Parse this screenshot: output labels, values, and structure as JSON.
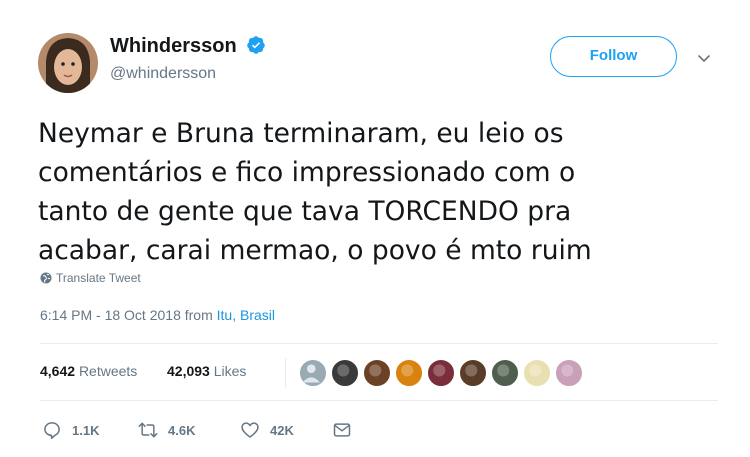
{
  "user": {
    "display_name": "Whindersson",
    "handle": "@whindersson",
    "verified": true
  },
  "follow_label": "Follow",
  "tweet": {
    "text_lines": [
      "Neymar e Bruna terminaram, eu leio os",
      "comentários e fico impressionado com o",
      "tanto de gente que tava TORCENDO pra",
      "acabar, carai mermao, o povo é mto ruim"
    ],
    "translate_label": "Translate Tweet",
    "time": "6:14 PM - 18 Oct 2018",
    "from_label": "from",
    "location": "Itu, Brasil"
  },
  "stats": {
    "retweets_count": "4,642",
    "retweets_label": "Retweets",
    "likes_count": "42,093",
    "likes_label": "Likes"
  },
  "liker_avatars": [
    {
      "icon": "default-avatar-icon",
      "color": "#99aab5"
    },
    {
      "icon": "avatar",
      "color": "#3a3a3a"
    },
    {
      "icon": "avatar",
      "color": "#6b4226"
    },
    {
      "icon": "avatar",
      "color": "#d9820f"
    },
    {
      "icon": "avatar",
      "color": "#7a2e3b"
    },
    {
      "icon": "avatar",
      "color": "#5a3d28"
    },
    {
      "icon": "avatar",
      "color": "#4f5f4f"
    },
    {
      "icon": "avatar",
      "color": "#e8e0b0"
    },
    {
      "icon": "avatar",
      "color": "#c9a0b8"
    }
  ],
  "actions": {
    "reply_count": "1.1K",
    "retweet_count": "4.6K",
    "like_count": "42K"
  },
  "colors": {
    "accent": "#1da1f2",
    "text": "#14171a",
    "muted": "#657786",
    "link": "#1b95e0"
  }
}
